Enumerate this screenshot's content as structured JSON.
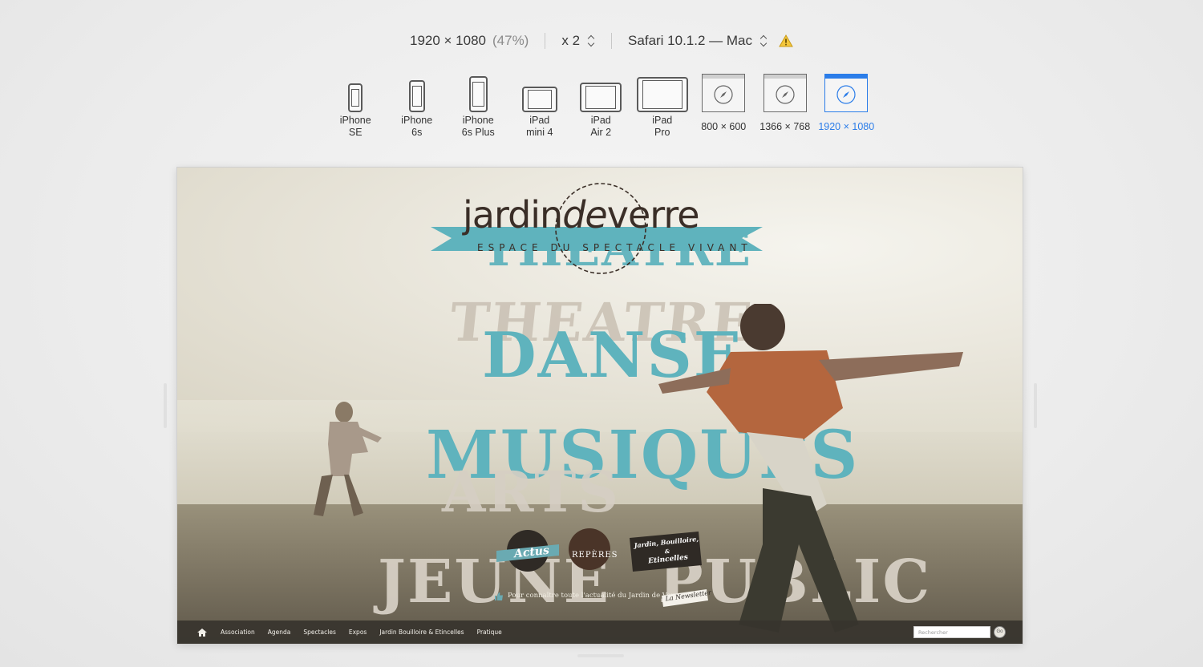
{
  "toolbar": {
    "resolution": "1920 × 1080",
    "zoom_percent": "(47%)",
    "scale": "x 2",
    "browser": "Safari 10.1.2 — Mac"
  },
  "devices": [
    {
      "line1": "iPhone",
      "line2": "SE",
      "kind": "phone"
    },
    {
      "line1": "iPhone",
      "line2": "6s",
      "kind": "phone"
    },
    {
      "line1": "iPhone",
      "line2": "6s Plus",
      "kind": "phone"
    },
    {
      "line1": "iPad",
      "line2": "mini 4",
      "kind": "tablet"
    },
    {
      "line1": "iPad",
      "line2": "Air 2",
      "kind": "tablet"
    },
    {
      "line1": "iPad",
      "line2": "Pro",
      "kind": "tablet"
    },
    {
      "line1": "800 × 600",
      "line2": "",
      "kind": "window"
    },
    {
      "line1": "1366 × 768",
      "line2": "",
      "kind": "window"
    },
    {
      "line1": "1920 × 1080",
      "line2": "",
      "kind": "window",
      "active": true
    }
  ],
  "site": {
    "logo_main_a": "jardin",
    "logo_main_de": "de",
    "logo_main_b": "verre",
    "logo_sub": "ESPACE DU SPECTACLE VIVANT",
    "word_theatre": "THEATRE",
    "word_danse": "DANSE",
    "word_musiques": "MUSIQUES",
    "word_arts": "ARTS",
    "word_jeune": "JEUNE",
    "word_public": "PUBLIC",
    "badge_actus": "Actus",
    "badge_reperes": "REPÈRES",
    "badge_jardin_1": "Jardin, Bouilloire,",
    "badge_jardin_2": "&",
    "badge_jardin_3": "Etincelles",
    "newsletter_line": "Pour connaître toute l'actualité du Jardin de Verre",
    "newsletter_label": "La Newsletter",
    "nav": [
      "Association",
      "Agenda",
      "Spectacles",
      "Expos",
      "Jardin Bouilloire & Etincelles",
      "Pratique"
    ],
    "search_placeholder": "Rechercher",
    "go_label": "Go",
    "colors": {
      "teal": "#5fb3bd",
      "brown": "#3a2e27",
      "cream": "#d9d2c7"
    }
  }
}
